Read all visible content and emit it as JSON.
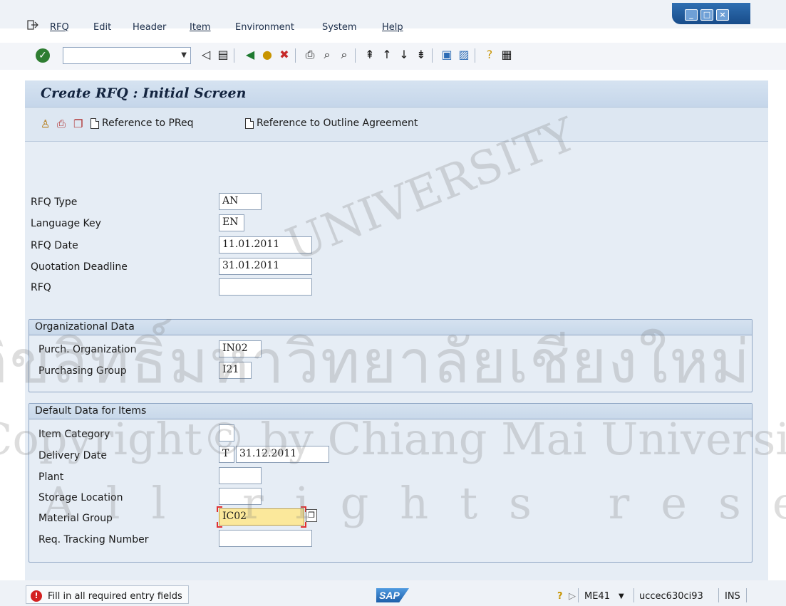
{
  "menu": {
    "items": [
      "RFQ",
      "Edit",
      "Header",
      "Item",
      "Environment",
      "System",
      "Help"
    ]
  },
  "toolbar": {
    "command_value": "",
    "icons": [
      "enter-icon",
      "back-arrow-icon",
      "save-icon",
      "back-icon",
      "exit-icon",
      "cancel-icon",
      "print-icon",
      "find-icon",
      "find-next-icon",
      "first-page-icon",
      "previous-page-icon",
      "next-page-icon",
      "last-page-icon",
      "create-session-icon",
      "shortcut-icon",
      "help-icon",
      "layout-icon"
    ]
  },
  "title": "Create RFQ : Initial Screen",
  "app_toolbar": {
    "reference_preq": "Reference to PReq",
    "reference_outline": "Reference to Outline Agreement"
  },
  "fields": {
    "rfq_type": {
      "label": "RFQ Type",
      "value": "AN"
    },
    "language_key": {
      "label": "Language Key",
      "value": "EN"
    },
    "rfq_date": {
      "label": "RFQ Date",
      "value": "11.01.2011"
    },
    "quotation_deadline": {
      "label": "Quotation Deadline",
      "value": "31.01.2011"
    },
    "rfq": {
      "label": "RFQ",
      "value": ""
    }
  },
  "org_data": {
    "title": "Organizational Data",
    "purch_org": {
      "label": "Purch. Organization",
      "value": "IN02"
    },
    "purch_group": {
      "label": "Purchasing Group",
      "value": "I21"
    }
  },
  "default_data": {
    "title": "Default Data for Items",
    "item_category": {
      "label": "Item Category",
      "value": ""
    },
    "delivery_date": {
      "label": "Delivery Date",
      "prefix": "T",
      "value": "31.12.2011"
    },
    "plant": {
      "label": "Plant",
      "value": ""
    },
    "storage_location": {
      "label": "Storage Location",
      "value": ""
    },
    "material_group": {
      "label": "Material Group",
      "value": "IC02"
    },
    "req_tracking": {
      "label": "Req. Tracking Number",
      "value": ""
    }
  },
  "status": {
    "message": "Fill in all required entry fields",
    "transaction": "ME41",
    "server": "uccec630ci93",
    "mode": "INS"
  },
  "watermark": {
    "line1": "UNIVERSITY",
    "line2": "Copyright© by Chiang Mai University",
    "line3": "All rights reserved",
    "thai": "ลิขสิทธิ์มหาวิทยาลัยเชียงใหม่"
  },
  "colors": {
    "active_field": "#fbe89b",
    "error": "#d32020",
    "title_bg": "#d6e3f1"
  }
}
